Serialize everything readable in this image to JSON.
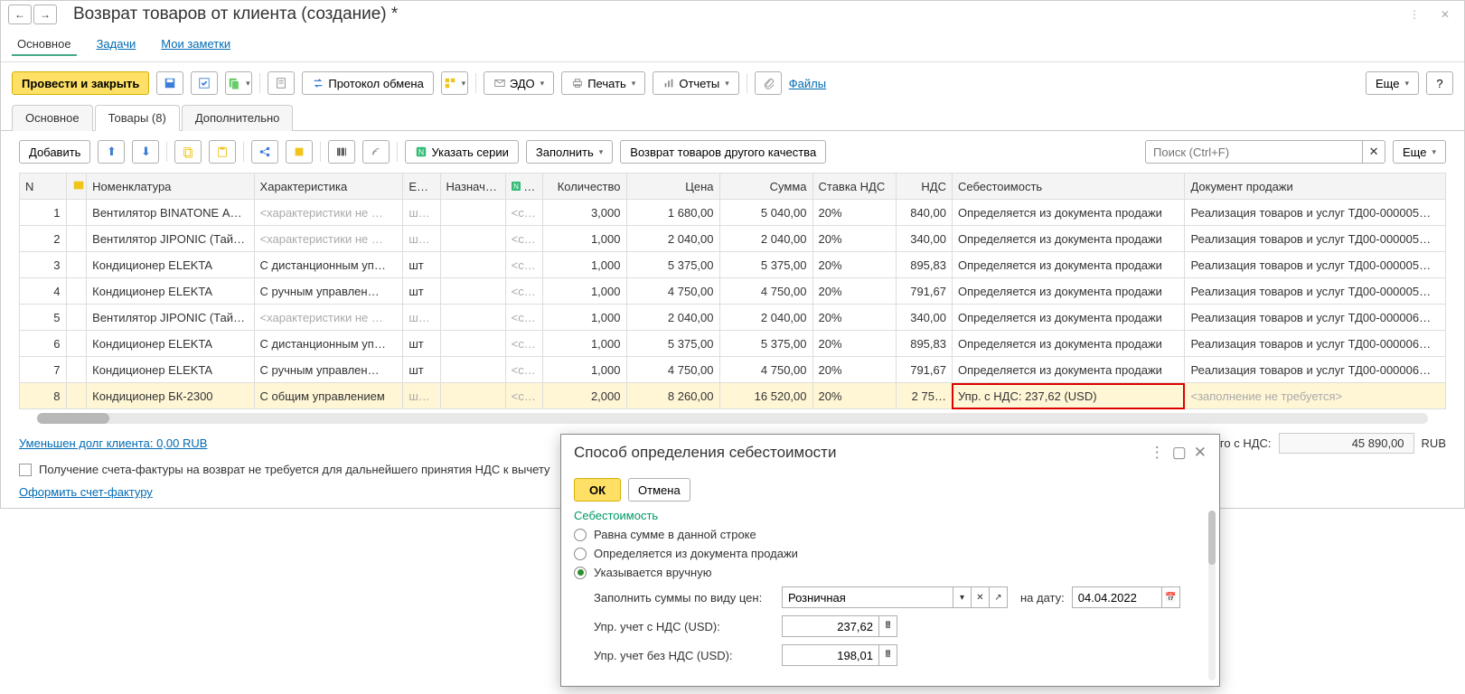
{
  "header": {
    "title": "Возврат товаров от клиента (создание) *"
  },
  "tabs1": {
    "main": "Основное",
    "tasks": "Задачи",
    "notes": "Мои заметки"
  },
  "toolbar": {
    "post_close": "Провести и закрыть",
    "exchange_protocol": "Протокол обмена",
    "edo": "ЭДО",
    "print": "Печать",
    "reports": "Отчеты",
    "files": "Файлы",
    "more": "Еще"
  },
  "subtabs": {
    "main": "Основное",
    "goods": "Товары (8)",
    "extra": "Дополнительно"
  },
  "toolbar2": {
    "add": "Добавить",
    "series": "Указать серии",
    "fill": "Заполнить",
    "return_quality": "Возврат товаров другого качества",
    "search_placeholder": "Поиск (Ctrl+F)",
    "more": "Еще"
  },
  "grid": {
    "cols": {
      "n": "N",
      "nom": "Номенклатура",
      "char": "Характеристика",
      "unit": "Е…",
      "purpose": "Назнач…",
      "ser": "С…",
      "qty": "Количество",
      "price": "Цена",
      "sum": "Сумма",
      "vat_rate": "Ставка НДС",
      "vat": "НДС",
      "cost": "Себестоимость",
      "doc": "Документ продажи"
    },
    "rows": [
      {
        "n": "1",
        "nom": "Вентилятор BINATONE А…",
        "char": "<характеристики не …",
        "unit": "шт…",
        "ser": "<се…",
        "qty": "3,000",
        "price": "1 680,00",
        "sum": "5 040,00",
        "vat_rate": "20%",
        "vat": "840,00",
        "cost": "Определяется из документа продажи",
        "doc": "Реализация товаров и услуг ТД00-000005…"
      },
      {
        "n": "2",
        "nom": "Вентилятор JIPONIC (Тай…",
        "char": "<характеристики не …",
        "unit": "шт…",
        "ser": "<се…",
        "qty": "1,000",
        "price": "2 040,00",
        "sum": "2 040,00",
        "vat_rate": "20%",
        "vat": "340,00",
        "cost": "Определяется из документа продажи",
        "doc": "Реализация товаров и услуг ТД00-000005…"
      },
      {
        "n": "3",
        "nom": "Кондиционер ELEKTA",
        "char": "С дистанционным уп…",
        "unit": "шт",
        "ser": "<се…",
        "qty": "1,000",
        "price": "5 375,00",
        "sum": "5 375,00",
        "vat_rate": "20%",
        "vat": "895,83",
        "cost": "Определяется из документа продажи",
        "doc": "Реализация товаров и услуг ТД00-000005…"
      },
      {
        "n": "4",
        "nom": "Кондиционер ELEKTA",
        "char": "С ручным управлен…",
        "unit": "шт",
        "ser": "<се…",
        "qty": "1,000",
        "price": "4 750,00",
        "sum": "4 750,00",
        "vat_rate": "20%",
        "vat": "791,67",
        "cost": "Определяется из документа продажи",
        "doc": "Реализация товаров и услуг ТД00-000005…"
      },
      {
        "n": "5",
        "nom": "Вентилятор JIPONIC (Тай…",
        "char": "<характеристики не …",
        "unit": "шт…",
        "ser": "<се…",
        "qty": "1,000",
        "price": "2 040,00",
        "sum": "2 040,00",
        "vat_rate": "20%",
        "vat": "340,00",
        "cost": "Определяется из документа продажи",
        "doc": "Реализация товаров и услуг ТД00-000006…"
      },
      {
        "n": "6",
        "nom": "Кондиционер ELEKTA",
        "char": "С дистанционным уп…",
        "unit": "шт",
        "ser": "<се…",
        "qty": "1,000",
        "price": "5 375,00",
        "sum": "5 375,00",
        "vat_rate": "20%",
        "vat": "895,83",
        "cost": "Определяется из документа продажи",
        "doc": "Реализация товаров и услуг ТД00-000006…"
      },
      {
        "n": "7",
        "nom": "Кондиционер ELEKTA",
        "char": "С ручным управлен…",
        "unit": "шт",
        "ser": "<се…",
        "qty": "1,000",
        "price": "4 750,00",
        "sum": "4 750,00",
        "vat_rate": "20%",
        "vat": "791,67",
        "cost": "Определяется из документа продажи",
        "doc": "Реализация товаров и услуг ТД00-000006…"
      },
      {
        "n": "8",
        "nom": "Кондиционер БК-2300",
        "char": "С общим управлением",
        "unit": "шт…",
        "ser": "<се…",
        "qty": "2,000",
        "price": "8 260,00",
        "sum": "16 520,00",
        "vat_rate": "20%",
        "vat": "2 75…",
        "cost": "Упр. с НДС: 237,62 (USD)",
        "doc": "<заполнение не требуется>"
      }
    ]
  },
  "footer": {
    "debt_link": "Уменьшен долг клиента: 0,00 RUB",
    "checkbox_label": "Получение счета-фактуры на возврат не требуется для дальнейшего принятия НДС к вычету",
    "invoice_link": "Оформить счет-фактуру",
    "total_label": "Всего с НДС:",
    "total_val": "45 890,00",
    "currency": "RUB"
  },
  "popup": {
    "title": "Способ определения себестоимости",
    "ok": "ОК",
    "cancel": "Отмена",
    "section": "Себестоимость",
    "r1": "Равна сумме в данной строке",
    "r2": "Определяется из документа продажи",
    "r3": "Указывается вручную",
    "price_type_label": "Заполнить суммы по виду цен:",
    "price_type": "Розничная",
    "date_label": "на дату:",
    "date": "04.04.2022",
    "f1_label": "Упр. учет с НДС (USD):",
    "f1_val": "237,62",
    "f2_label": "Упр. учет без НДС (USD):",
    "f2_val": "198,01"
  }
}
